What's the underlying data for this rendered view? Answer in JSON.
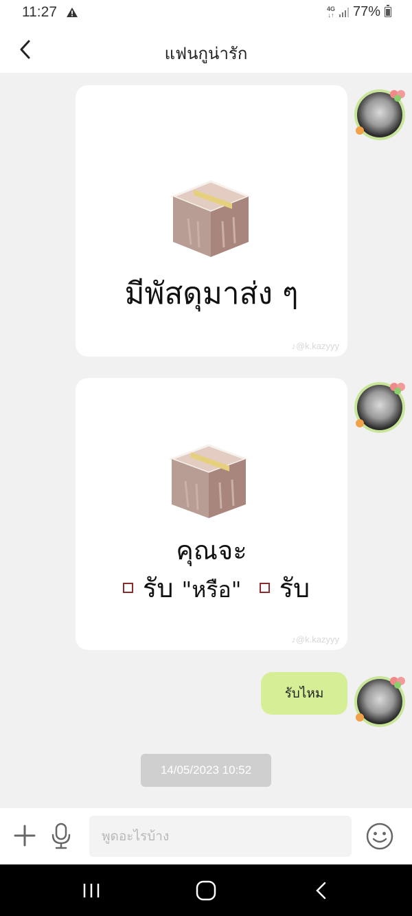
{
  "status": {
    "time": "11:27",
    "network": "4G",
    "battery": "77%"
  },
  "header": {
    "title": "แฟนกูน่ารัก"
  },
  "messages": {
    "sticker1": {
      "text": "มีพัสดุมาส่ง ๆ",
      "watermark": "♪@k.kazyyy"
    },
    "sticker2": {
      "line1": "คุณจะ",
      "option1": "รับ",
      "or": "\"หรือ\"",
      "option2": "รับ",
      "watermark": "♪@k.kazyyy"
    },
    "bubble": {
      "text": "รับไหม"
    }
  },
  "timestamp": "14/05/2023 10:52",
  "input": {
    "placeholder": "พูดอะไรบ้าง"
  },
  "colors": {
    "bubble": "#d6ef96",
    "avatar_ring": "#c8e59a",
    "background": "#f1f1f1"
  }
}
